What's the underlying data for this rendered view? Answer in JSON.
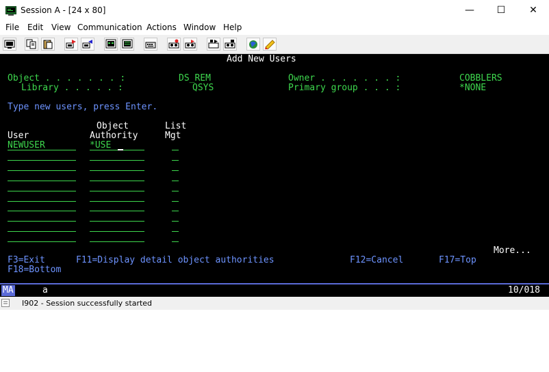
{
  "window": {
    "title": "Session A - [24 x 80]",
    "minimize_glyph": "—",
    "maximize_glyph": "☐",
    "close_glyph": "✕"
  },
  "menu": [
    "File",
    "Edit",
    "View",
    "Communication",
    "Actions",
    "Window",
    "Help"
  ],
  "toolbar": {
    "buttons": [
      "print-screen",
      "copy",
      "paste",
      "send",
      "receive",
      "display-keypad",
      "keypad",
      "record-macro",
      "play-macro",
      "stop-macro",
      "macro-play-2",
      "macro-3",
      "macro-4",
      "customize",
      "help"
    ]
  },
  "screen": {
    "heading": "Add New Users",
    "object_label": "Object . . . . . . . :",
    "object_value": "DS_REM",
    "library_label": "Library . . . . . :",
    "library_value": "QSYS",
    "owner_label": "Owner . . . . . . . :",
    "owner_value": "COBBLERS",
    "primary_group_label": "Primary group . . . :",
    "primary_group_value": "*NONE",
    "instruction": "Type new users, press Enter.",
    "columns": {
      "object_top": "Object",
      "list_top": "List",
      "user": "User",
      "authority": "Authority",
      "mgt": "Mgt"
    },
    "rows": [
      {
        "user": "NEWUSER",
        "authority": "*USE",
        "mgt": ""
      },
      {
        "user": "",
        "authority": "",
        "mgt": ""
      },
      {
        "user": "",
        "authority": "",
        "mgt": ""
      },
      {
        "user": "",
        "authority": "",
        "mgt": ""
      },
      {
        "user": "",
        "authority": "",
        "mgt": ""
      },
      {
        "user": "",
        "authority": "",
        "mgt": ""
      },
      {
        "user": "",
        "authority": "",
        "mgt": ""
      },
      {
        "user": "",
        "authority": "",
        "mgt": ""
      },
      {
        "user": "",
        "authority": "",
        "mgt": ""
      },
      {
        "user": "",
        "authority": "",
        "mgt": ""
      }
    ],
    "more": "More...",
    "fkeys": {
      "f3": "F3=Exit",
      "f11": "F11=Display detail object authorities",
      "f12": "F12=Cancel",
      "f17": "F17=Top",
      "f18": "F18=Bottom"
    }
  },
  "oia": {
    "mode": "MA",
    "input": "a",
    "cursor_position": "10/018"
  },
  "status": {
    "message": "I902 - Session successfully started"
  },
  "colors": {
    "screen_bg": "#000000",
    "field_green": "#3ed84e",
    "label_blue": "#6d93ff",
    "oia_accent": "#5b6bd8"
  }
}
